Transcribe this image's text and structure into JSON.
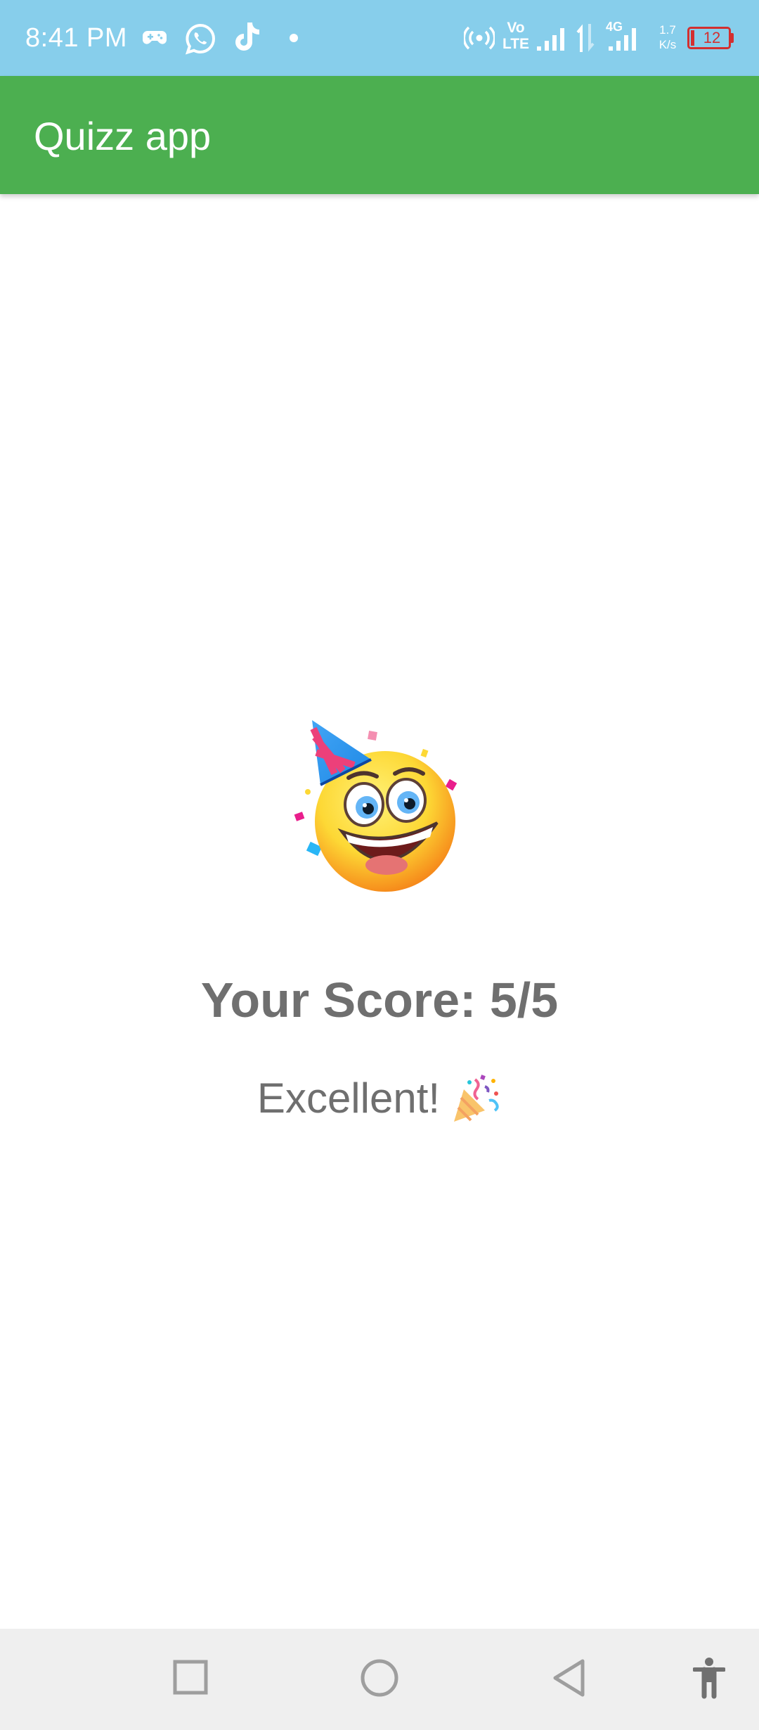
{
  "status_bar": {
    "time": "8:41 PM",
    "network_rate": "1.7",
    "network_rate_unit": "K/s",
    "battery_level": "12",
    "network_type": "4G",
    "volte_top": "Vo",
    "volte_bottom": "LTE",
    "icons": [
      "gamepad-icon",
      "whatsapp-icon",
      "tiktok-icon",
      "dot-icon",
      "hotspot-icon",
      "volte-icon",
      "signal-icon",
      "data-arrows-icon",
      "signal-4g-icon",
      "battery-icon"
    ]
  },
  "app_bar": {
    "title": "Quizz app"
  },
  "result": {
    "image": "party-smiley-emoji",
    "score_text": "Your Score: 5/5",
    "message": "Excellent!",
    "message_emoji": "party-popper-icon"
  },
  "nav_bar": {
    "buttons": [
      "recents-button",
      "home-button",
      "back-button",
      "accessibility-button"
    ]
  },
  "colors": {
    "status_bar": "#87ceeb",
    "app_bar": "#4caf50",
    "text_gray": "#6f6f6f",
    "nav_bar": "#efefef",
    "battery_low": "#d32f2f"
  }
}
